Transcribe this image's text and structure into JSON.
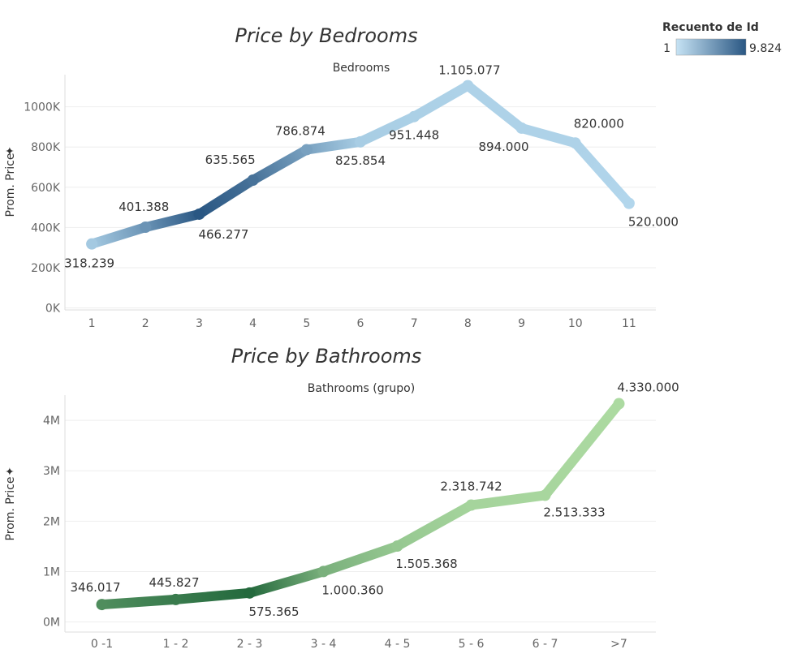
{
  "legend": {
    "title": "Recuento de Id",
    "min_label": "1",
    "max_label": "9.824",
    "min_color": "#c6e3f4",
    "max_color": "#2a5783"
  },
  "chart_data": [
    {
      "type": "line",
      "title": "Price by Bedrooms",
      "xlabel": "Bedrooms",
      "ylabel": "Prom. Price",
      "categories": [
        "1",
        "2",
        "3",
        "4",
        "5",
        "6",
        "7",
        "8",
        "9",
        "10",
        "11"
      ],
      "values": [
        318239,
        401388,
        466277,
        635565,
        786874,
        825854,
        951448,
        1105077,
        894000,
        820000,
        520000
      ],
      "data_labels": [
        "318.239",
        "401.388",
        "466.277",
        "635.565",
        "786.874",
        "825.854",
        "951.448",
        "1.105.077",
        "894.000",
        "820.000",
        "520.000"
      ],
      "color_intensity": [
        0.15,
        0.55,
        1.0,
        0.8,
        0.45,
        0.12,
        0.1,
        0.08,
        0.08,
        0.08,
        0.05
      ],
      "color_light": "#b9ddf1",
      "color_dark": "#2a5783",
      "yticks": [
        0,
        200000,
        400000,
        600000,
        800000,
        1000000
      ],
      "ytick_labels": [
        "0K",
        "200K",
        "400K",
        "600K",
        "800K",
        "1000K"
      ],
      "ylim": [
        -10000,
        1160000
      ],
      "grid": true
    },
    {
      "type": "line",
      "title": "Price by Bathrooms",
      "xlabel": "Bathrooms (grupo)",
      "ylabel": "Prom. Price",
      "categories": [
        "0 -1",
        "1 - 2",
        "2 - 3",
        "3 - 4",
        "4 - 5",
        "5 - 6",
        "6 - 7",
        ">7"
      ],
      "values": [
        346017,
        445827,
        575365,
        1000360,
        1505368,
        2318742,
        2513333,
        4330000
      ],
      "data_labels": [
        "346.017",
        "445.827",
        "575.365",
        "1.000.360",
        "1.505.368",
        "2.318.742",
        "2.513.333",
        "4.330.000"
      ],
      "color_intensity": [
        0.7,
        0.85,
        1.0,
        0.4,
        0.2,
        0.1,
        0.08,
        0.05
      ],
      "color_light": "#b3e0a6",
      "color_dark": "#24693d",
      "yticks": [
        0,
        1000000,
        2000000,
        3000000,
        4000000
      ],
      "ytick_labels": [
        "0M",
        "1M",
        "2M",
        "3M",
        "4M"
      ],
      "ylim": [
        -200000,
        4500000
      ],
      "grid": true
    }
  ]
}
